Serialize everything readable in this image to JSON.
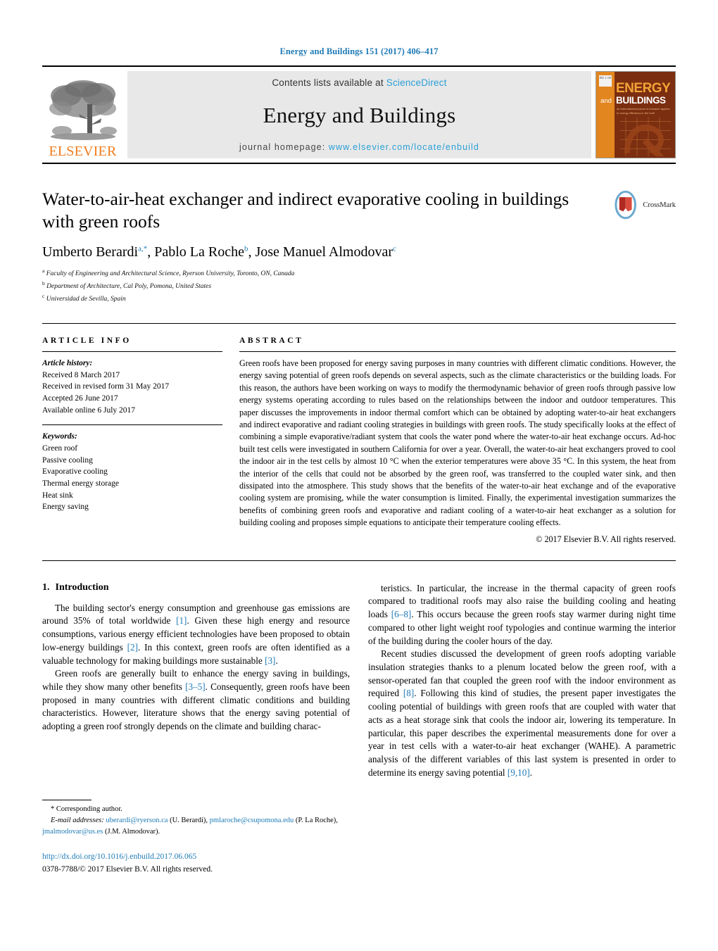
{
  "running_head": "Energy and Buildings 151 (2017) 406–417",
  "masthead": {
    "publisher_logo_text": "ELSEVIER",
    "contents_prefix": "Contents lists available at",
    "contents_link": "ScienceDirect",
    "journal_title": "Energy and Buildings",
    "homepage_prefix": "journal homepage:",
    "homepage_link": "www.elsevier.com/locate/enbuild",
    "cover": {
      "badge": "INT. J. OF",
      "and": "and",
      "energy": "ENERGY",
      "buildings": "BUILDINGS",
      "subtitle": "an international journal of research applied to energy efficiency in the built environment"
    }
  },
  "article": {
    "title": "Water-to-air-heat exchanger and indirect evaporative cooling in buildings with green roofs",
    "authors_html": "Umberto Berardi<sup>a,*</sup>, Pablo La Roche<sup>b</sup>, Jose Manuel Almodovar<sup>c</sup>",
    "affiliations": [
      {
        "mark": "a",
        "text": "Faculty of Engineering and Architectural Science, Ryerson University, Toronto, ON, Canada"
      },
      {
        "mark": "b",
        "text": "Department of Architecture, Cal Poly, Pomona, United States"
      },
      {
        "mark": "c",
        "text": "Universidad de Sevilla, Spain"
      }
    ],
    "crossmark_label": "CrossMark"
  },
  "article_info": {
    "heading": "ARTICLE INFO",
    "history_label": "Article history:",
    "history": [
      "Received 8 March 2017",
      "Received in revised form 31 May 2017",
      "Accepted 26 June 2017",
      "Available online 6 July 2017"
    ],
    "keywords_label": "Keywords:",
    "keywords": [
      "Green roof",
      "Passive cooling",
      "Evaporative cooling",
      "Thermal energy storage",
      "Heat sink",
      "Energy saving"
    ]
  },
  "abstract": {
    "heading": "ABSTRACT",
    "text": "Green roofs have been proposed for energy saving purposes in many countries with different climatic conditions. However, the energy saving potential of green roofs depends on several aspects, such as the climate characteristics or the building loads. For this reason, the authors have been working on ways to modify the thermodynamic behavior of green roofs through passive low energy systems operating according to rules based on the relationships between the indoor and outdoor temperatures. This paper discusses the improvements in indoor thermal comfort which can be obtained by adopting water-to-air heat exchangers and indirect evaporative and radiant cooling strategies in buildings with green roofs. The study specifically looks at the effect of combining a simple evaporative/radiant system that cools the water pond where the water-to-air heat exchange occurs. Ad-hoc built test cells were investigated in southern California for over a year. Overall, the water-to-air heat exchangers proved to cool the indoor air in the test cells by almost 10 °C when the exterior temperatures were above 35 °C. In this system, the heat from the interior of the cells that could not be absorbed by the green roof, was transferred to the coupled water sink, and then dissipated into the atmosphere. This study shows that the benefits of the water-to-air heat exchange and of the evaporative cooling system are promising, while the water consumption is limited. Finally, the experimental investigation summarizes the benefits of combining green roofs and evaporative and radiant cooling of a water-to-air heat exchanger as a solution for building cooling and proposes simple equations to anticipate their temperature cooling effects.",
    "copyright": "© 2017 Elsevier B.V. All rights reserved."
  },
  "introduction": {
    "number": "1.",
    "title": "Introduction",
    "left_paragraphs": [
      "The building sector's energy consumption and greenhouse gas emissions are around 35% of total worldwide [1]. Given these high energy and resource consumptions, various energy efficient technologies have been proposed to obtain low-energy buildings [2]. In this context, green roofs are often identified as a valuable technology for making buildings more sustainable [3].",
      "Green roofs are generally built to enhance the energy saving in buildings, while they show many other benefits [3–5]. Consequently, green roofs have been proposed in many countries with different climatic conditions and building characteristics. However, literature shows that the energy saving potential of adopting a green roof strongly depends on the climate and building charac-"
    ],
    "right_paragraphs": [
      "teristics. In particular, the increase in the thermal capacity of green roofs compared to traditional roofs may also raise the building cooling and heating loads [6–8]. This occurs because the green roofs stay warmer during night time compared to other light weight roof typologies and continue warming the interior of the building during the cooler hours of the day.",
      "Recent studies discussed the development of green roofs adopting variable insulation strategies thanks to a plenum located below the green roof, with a sensor-operated fan that coupled the green roof with the indoor environment as required [8]. Following this kind of studies, the present paper investigates the cooling potential of buildings with green roofs that are coupled with water that acts as a heat storage sink that cools the indoor air, lowering its temperature. In particular, this paper describes the experimental measurements done for over a year in test cells with a water-to-air heat exchanger (WAHE). A parametric analysis of the different variables of this last system is presented in order to determine its energy saving potential [9,10]."
    ]
  },
  "footnotes": {
    "corresponding": "* Corresponding author.",
    "email_label": "E-mail addresses:",
    "emails": [
      {
        "address": "uberardi@ryerson.ca",
        "name": "(U. Berardi),"
      },
      {
        "address": "pmlaroche@csupomona.edu",
        "name": "(P. La Roche),"
      },
      {
        "address": "jmalmodovar@us.es",
        "name": "(J.M. Almodovar)."
      }
    ],
    "doi": "http://dx.doi.org/10.1016/j.enbuild.2017.06.065",
    "issn_line": "0378-7788/© 2017 Elsevier B.V. All rights reserved."
  },
  "colors": {
    "link_blue": "#1f7bb6",
    "sciencedirect_blue": "#2a9fd6",
    "elsevier_orange": "#f07c1f",
    "cover_dark": "#7b2e10",
    "cover_orange": "#e2861f"
  }
}
